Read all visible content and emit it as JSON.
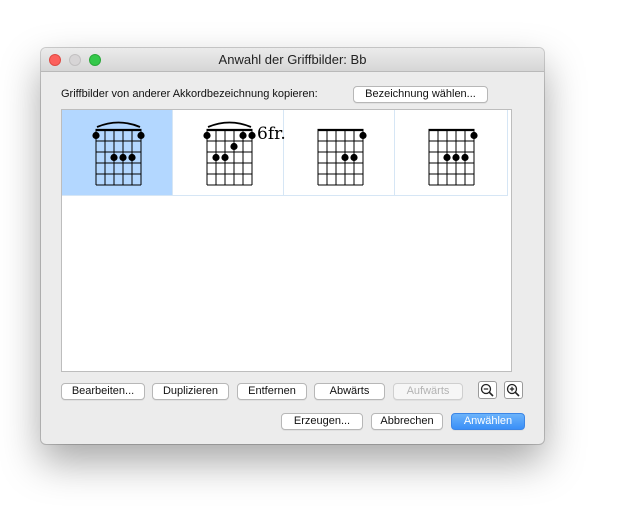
{
  "window": {
    "title": "Anwahl der Griffbilder: Bb"
  },
  "copy_section": {
    "label": "Griffbilder von anderer Akkordbezeichnung kopieren:",
    "choose_button": "Bezeichnung wählen..."
  },
  "chord_diagrams": [
    {
      "fret_label": "",
      "selected": true,
      "barre": true,
      "dots": [
        {
          "string": 1,
          "fret": 1
        },
        {
          "string": 6,
          "fret": 1
        },
        {
          "string": 3,
          "fret": 3
        },
        {
          "string": 4,
          "fret": 3
        },
        {
          "string": 5,
          "fret": 3
        }
      ]
    },
    {
      "fret_label": "6fr.",
      "selected": false,
      "barre": true,
      "dots": [
        {
          "string": 1,
          "fret": 1
        },
        {
          "string": 5,
          "fret": 1
        },
        {
          "string": 6,
          "fret": 1
        },
        {
          "string": 4,
          "fret": 2
        },
        {
          "string": 2,
          "fret": 3
        },
        {
          "string": 3,
          "fret": 3
        }
      ]
    },
    {
      "fret_label": "",
      "selected": false,
      "barre": false,
      "dots": [
        {
          "string": 6,
          "fret": 1
        },
        {
          "string": 4,
          "fret": 3
        },
        {
          "string": 5,
          "fret": 3
        }
      ]
    },
    {
      "fret_label": "",
      "selected": false,
      "barre": false,
      "dots": [
        {
          "string": 6,
          "fret": 1
        },
        {
          "string": 3,
          "fret": 3
        },
        {
          "string": 4,
          "fret": 3
        },
        {
          "string": 5,
          "fret": 3
        }
      ]
    }
  ],
  "toolbar": {
    "edit": "Bearbeiten...",
    "duplicate": "Duplizieren",
    "remove": "Entfernen",
    "down": "Abwärts",
    "up": "Aufwärts",
    "zoom_out_icon": "zoom-out-icon",
    "zoom_in_icon": "zoom-in-icon"
  },
  "footer": {
    "create": "Erzeugen...",
    "cancel": "Abbrechen",
    "select": "Anwählen"
  },
  "colors": {
    "selection": "#b3d7ff",
    "primary_button": "#3a8ff8",
    "close": "#fc605c",
    "zoom": "#34c84a"
  }
}
